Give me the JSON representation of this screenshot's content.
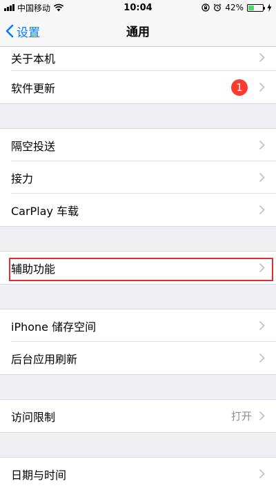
{
  "status_bar": {
    "carrier": "中国移动",
    "time": "10:04",
    "battery": "42%",
    "battery_level": 0.42
  },
  "nav": {
    "back_label": "设置",
    "title": "通用"
  },
  "groups": [
    {
      "items": [
        {
          "label": "关于本机"
        },
        {
          "label": "软件更新",
          "badge": "1"
        }
      ]
    },
    {
      "items": [
        {
          "label": "隔空投送"
        },
        {
          "label": "接力"
        },
        {
          "label": "CarPlay 车载"
        }
      ]
    },
    {
      "items": [
        {
          "label": "辅助功能"
        }
      ]
    },
    {
      "items": [
        {
          "label": "iPhone 储存空间"
        },
        {
          "label": "后台应用刷新"
        }
      ]
    },
    {
      "items": [
        {
          "label": "访问限制",
          "detail": "打开"
        }
      ]
    },
    {
      "items": [
        {
          "label": "日期与时间"
        }
      ]
    }
  ],
  "colors": {
    "accent": "#007aff",
    "badge": "#ff3b30",
    "highlight": "#e02d2d"
  }
}
